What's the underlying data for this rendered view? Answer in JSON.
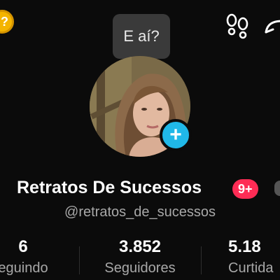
{
  "bubble": {
    "text": "E aí?"
  },
  "profile": {
    "display_name": "Retratos De Sucessos",
    "notification_badge": "9+",
    "username": "@retratos_de_sucessos"
  },
  "stats": {
    "following": {
      "value": "6",
      "label": "eguindo"
    },
    "followers": {
      "value": "3.852",
      "label": "Seguidores"
    },
    "likes": {
      "value": "5.18",
      "label": "Curtida"
    }
  },
  "icons": {
    "coin": "coin-icon",
    "footprints": "footprints-icon",
    "share": "share-icon",
    "add": "plus-icon"
  },
  "colors": {
    "background": "#0b0b0b",
    "accent_blue": "#20b8e8",
    "badge_red": "#fe2c55",
    "coin_yellow": "#f4b400",
    "bubble_gray": "#3a3a3a",
    "secondary_text": "#a8a8a8"
  }
}
